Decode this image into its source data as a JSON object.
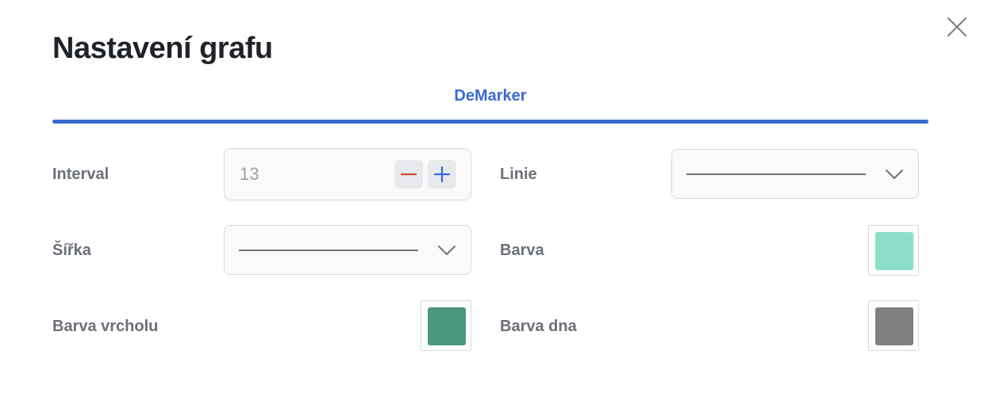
{
  "dialog": {
    "title": "Nastavení grafu",
    "close_icon": "close-icon"
  },
  "tabs": [
    {
      "label": "DeMarker",
      "active": true
    }
  ],
  "settings": {
    "interval": {
      "label": "Interval",
      "value": "13",
      "decrement_icon": "minus-icon",
      "increment_icon": "plus-icon",
      "decrement_color": "#d14a2e",
      "increment_color": "#3a6ad0"
    },
    "width": {
      "label": "Šířka",
      "chevron_icon": "chevron-down-icon"
    },
    "peak_color": {
      "label": "Barva vrcholu",
      "color": "#4a977e"
    },
    "line": {
      "label": "Linie",
      "chevron_icon": "chevron-down-icon"
    },
    "color": {
      "label": "Barva",
      "color": "#8adfc6"
    },
    "bottom_color": {
      "label": "Barva dna",
      "color": "#808080"
    }
  },
  "theme": {
    "accent": "#3a6ad0",
    "label_color": "#6b7079"
  }
}
